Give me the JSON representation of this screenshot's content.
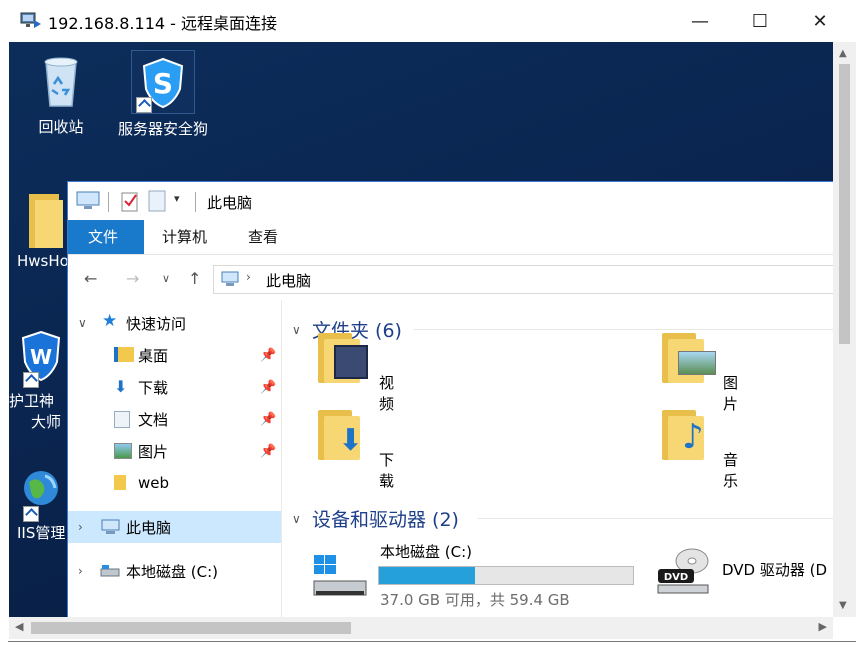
{
  "rdp_window": {
    "title": "192.168.8.114 - 远程桌面连接",
    "controls": [
      "—",
      "☐",
      "✕"
    ]
  },
  "desktop": {
    "icons": [
      {
        "label": "回收站",
        "icon": "recycle-bin-icon"
      },
      {
        "label": "服务器安全狗",
        "icon": "safedog-shield-icon"
      },
      {
        "label": "HwsHo",
        "icon": "folder-icon"
      },
      {
        "label": "护卫神",
        "label2": "大师",
        "icon": "huweishen-shield-icon"
      },
      {
        "label": "IIS管理",
        "icon": "globe-icon"
      }
    ]
  },
  "explorer": {
    "qat_title": "此电脑",
    "ribbon_tabs": [
      "文件",
      "计算机",
      "查看"
    ],
    "address": "此电脑",
    "nav": {
      "quick_access": "快速访问",
      "items": [
        {
          "label": "桌面",
          "pinned": true
        },
        {
          "label": "下载",
          "pinned": true
        },
        {
          "label": "文档",
          "pinned": true
        },
        {
          "label": "图片",
          "pinned": true
        },
        {
          "label": "web",
          "pinned": false
        }
      ],
      "this_pc": "此电脑",
      "local_disk": "本地磁盘 (C:)"
    },
    "folders_header": "文件夹 (6)",
    "folders": [
      "视频",
      "图片",
      "下载",
      "音乐"
    ],
    "devices_header": "设备和驱动器 (2)",
    "drives": [
      {
        "label": "本地磁盘 (C:)",
        "space": "37.0 GB 可用，共 59.4 GB",
        "used_fraction": 0.377
      },
      {
        "label": "DVD 驱动器 (D"
      }
    ]
  },
  "colors": {
    "desktop_bg": "#0a2550",
    "file_tab": "#1979ca",
    "selection": "#cce8ff",
    "header_text": "#1e3f8a",
    "disk_bar": "#26a0da"
  }
}
